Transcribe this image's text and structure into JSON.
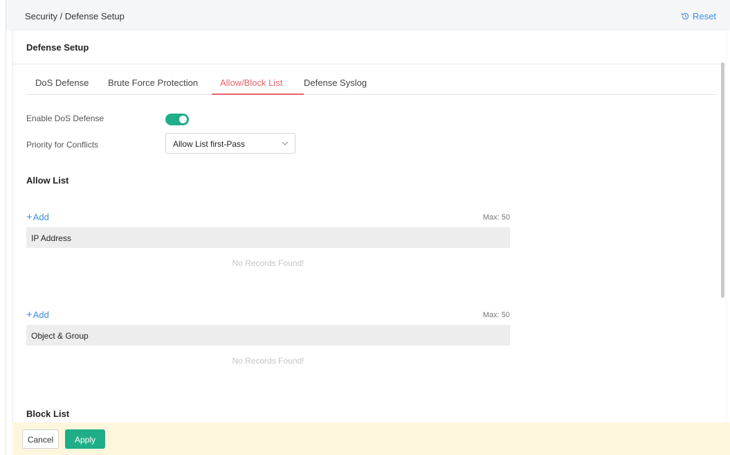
{
  "breadcrumb": "Security / Defense Setup",
  "reset_label": "Reset",
  "card_title": "Defense Setup",
  "tabs": [
    {
      "label": "DoS Defense",
      "active": false
    },
    {
      "label": "Brute Force Protection",
      "active": false
    },
    {
      "label": "Allow/Block List",
      "active": true
    },
    {
      "label": "Defense Syslog",
      "active": false
    }
  ],
  "form": {
    "enable_label": "Enable DoS Defense",
    "enable_value": true,
    "priority_label": "Priority for Conflicts",
    "priority_value": "Allow List first-Pass"
  },
  "allow_list": {
    "title": "Allow List",
    "ip_block": {
      "add_label": "Add",
      "max_label": "Max: 50",
      "column": "IP Address",
      "empty": "No Records Found!"
    },
    "object_block": {
      "add_label": "Add",
      "max_label": "Max: 50",
      "column": "Object & Group",
      "empty": "No Records Found!"
    }
  },
  "block_list": {
    "title": "Block List"
  },
  "footer": {
    "cancel_label": "Cancel",
    "apply_label": "Apply"
  },
  "colors": {
    "accent": "#1fae88",
    "active_tab": "#e8626a",
    "link": "#3a8ee6",
    "footer_bg": "#fcf6dc"
  }
}
